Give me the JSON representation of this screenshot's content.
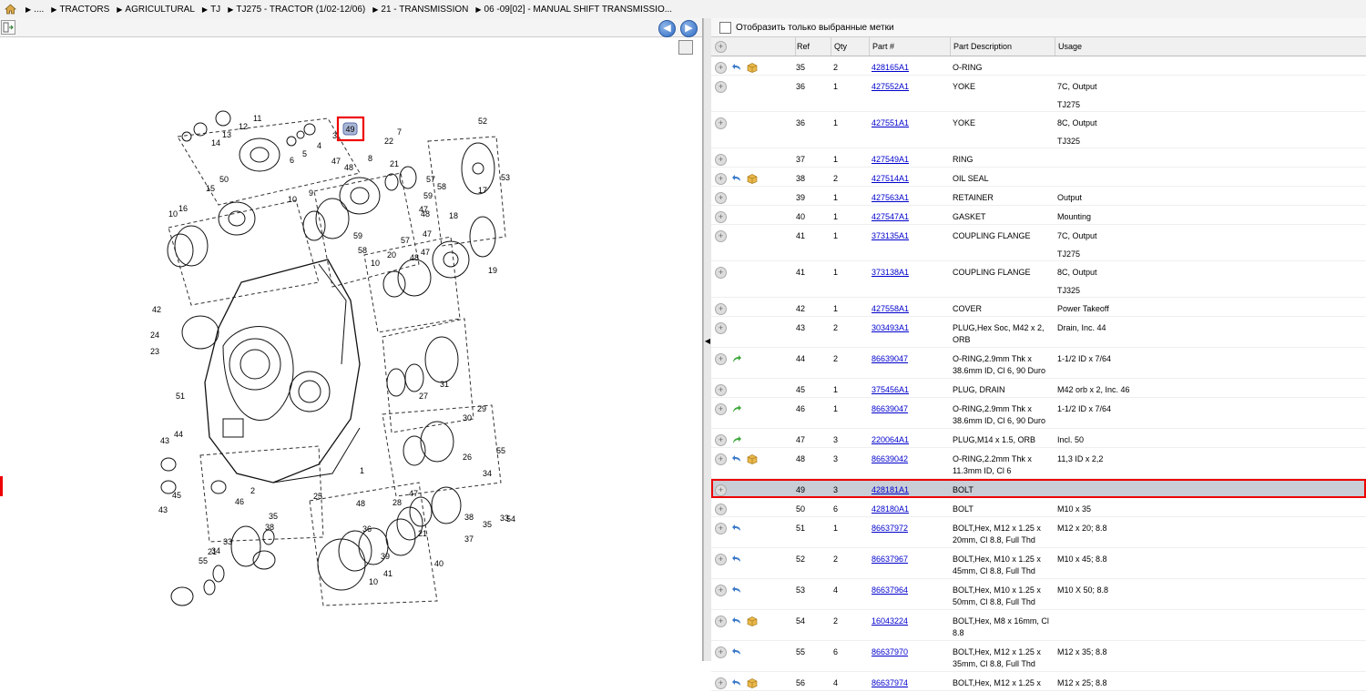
{
  "breadcrumb": {
    "items": [
      "....",
      "TRACTORS",
      "AGRICULTURAL",
      "TJ",
      "TJ275 - TRACTOR (1/02-12/06)",
      "21 - TRANSMISSION",
      "06 -09[02] - MANUAL SHIFT TRANSMISSIO..."
    ]
  },
  "diagram": {
    "highlight_label": "49",
    "callouts": [
      "11",
      "12",
      "13",
      "14",
      "6",
      "5",
      "4",
      "3",
      "49",
      "52",
      "7",
      "22",
      "8",
      "47",
      "48",
      "21",
      "57",
      "58",
      "59",
      "17",
      "53",
      "50",
      "15",
      "16",
      "10",
      "9",
      "10",
      "47",
      "48",
      "59",
      "57",
      "47",
      "18",
      "58",
      "47",
      "48",
      "20",
      "19",
      "10",
      "42",
      "24",
      "23",
      "51",
      "43",
      "44",
      "43",
      "45",
      "46",
      "2",
      "1",
      "25",
      "27",
      "31",
      "30",
      "29",
      "55",
      "26",
      "34",
      "33",
      "35",
      "54",
      "28",
      "47",
      "48",
      "36",
      "37",
      "38",
      "21",
      "40",
      "39",
      "10",
      "41",
      "38",
      "35",
      "34",
      "33",
      "55",
      "21"
    ]
  },
  "filter": {
    "label": "Отобразить только выбранные метки"
  },
  "table": {
    "headers": [
      "Ref",
      "Qty",
      "Part #",
      "Part Description",
      "Usage"
    ],
    "rows": [
      {
        "ref": "35",
        "qty": "2",
        "part": "428165A1",
        "desc": [
          "O-RING"
        ],
        "usage": [],
        "icons": [
          "undo",
          "box"
        ]
      },
      {
        "ref": "36",
        "qty": "1",
        "part": "427552A1",
        "desc": [
          "YOKE"
        ],
        "usage": [
          "7C, Output",
          "TJ275"
        ],
        "icons": []
      },
      {
        "ref": "36",
        "qty": "1",
        "part": "427551A1",
        "desc": [
          "YOKE"
        ],
        "usage": [
          "8C, Output",
          "TJ325"
        ],
        "icons": []
      },
      {
        "ref": "37",
        "qty": "1",
        "part": "427549A1",
        "desc": [
          "RING"
        ],
        "usage": [],
        "icons": []
      },
      {
        "ref": "38",
        "qty": "2",
        "part": "427514A1",
        "desc": [
          "OIL SEAL"
        ],
        "usage": [],
        "icons": [
          "undo",
          "box"
        ]
      },
      {
        "ref": "39",
        "qty": "1",
        "part": "427563A1",
        "desc": [
          "RETAINER"
        ],
        "usage": [
          "Output"
        ],
        "icons": []
      },
      {
        "ref": "40",
        "qty": "1",
        "part": "427547A1",
        "desc": [
          "GASKET"
        ],
        "usage": [
          "Mounting"
        ],
        "icons": []
      },
      {
        "ref": "41",
        "qty": "1",
        "part": "373135A1",
        "desc": [
          "COUPLING FLANGE"
        ],
        "usage": [
          "7C, Output",
          "TJ275"
        ],
        "icons": []
      },
      {
        "ref": "41",
        "qty": "1",
        "part": "373138A1",
        "desc": [
          "COUPLING FLANGE"
        ],
        "usage": [
          "8C, Output",
          "TJ325"
        ],
        "icons": []
      },
      {
        "ref": "42",
        "qty": "1",
        "part": "427558A1",
        "desc": [
          "COVER"
        ],
        "usage": [
          "Power Takeoff"
        ],
        "icons": []
      },
      {
        "ref": "43",
        "qty": "2",
        "part": "303493A1",
        "desc": [
          "PLUG,Hex Soc, M42 x 2,",
          "ORB"
        ],
        "usage": [
          "Drain, Inc. 44"
        ],
        "icons": []
      },
      {
        "ref": "44",
        "qty": "2",
        "part": "86639047",
        "desc": [
          "O-RING,2.9mm Thk x",
          "38.6mm ID, Cl 6, 90 Duro"
        ],
        "usage": [
          "1-1/2 ID x 7/64"
        ],
        "icons": [
          "redo"
        ]
      },
      {
        "ref": "45",
        "qty": "1",
        "part": "375456A1",
        "desc": [
          "PLUG, DRAIN"
        ],
        "usage": [
          "M42 orb x 2, Inc. 46"
        ],
        "icons": []
      },
      {
        "ref": "46",
        "qty": "1",
        "part": "86639047",
        "desc": [
          "O-RING,2.9mm Thk x",
          "38.6mm ID, Cl 6, 90 Duro"
        ],
        "usage": [
          "1-1/2 ID x 7/64"
        ],
        "icons": [
          "redo"
        ]
      },
      {
        "ref": "47",
        "qty": "3",
        "part": "220064A1",
        "desc": [
          "PLUG,M14 x 1.5, ORB"
        ],
        "usage": [
          "Incl. 50"
        ],
        "icons": [
          "redo"
        ]
      },
      {
        "ref": "48",
        "qty": "3",
        "part": "86639042",
        "desc": [
          "O-RING,2.2mm Thk x",
          "11.3mm ID, Cl 6"
        ],
        "usage": [
          "11,3 ID x 2,2"
        ],
        "icons": [
          "undo",
          "box"
        ]
      },
      {
        "ref": "49",
        "qty": "3",
        "part": "428181A1",
        "desc": [
          "BOLT"
        ],
        "usage": [],
        "icons": [],
        "selected": true
      },
      {
        "ref": "50",
        "qty": "6",
        "part": "428180A1",
        "desc": [
          "BOLT"
        ],
        "usage": [
          "M10 x 35"
        ],
        "icons": []
      },
      {
        "ref": "51",
        "qty": "1",
        "part": "86637972",
        "desc": [
          "BOLT,Hex, M12 x 1.25 x",
          "20mm, Cl 8.8, Full Thd"
        ],
        "usage": [
          "M12 x 20; 8.8"
        ],
        "icons": [
          "undo"
        ]
      },
      {
        "ref": "52",
        "qty": "2",
        "part": "86637967",
        "desc": [
          "BOLT,Hex, M10 x 1.25 x",
          "45mm, Cl 8.8, Full Thd"
        ],
        "usage": [
          "M10 x 45; 8.8"
        ],
        "icons": [
          "undo"
        ]
      },
      {
        "ref": "53",
        "qty": "4",
        "part": "86637964",
        "desc": [
          "BOLT,Hex, M10 x 1.25 x",
          "50mm, Cl 8.8, Full Thd"
        ],
        "usage": [
          "M10 X 50; 8.8"
        ],
        "icons": [
          "undo"
        ]
      },
      {
        "ref": "54",
        "qty": "2",
        "part": "16043224",
        "desc": [
          "BOLT,Hex, M8 x 16mm, Cl",
          "8.8"
        ],
        "usage": [],
        "icons": [
          "undo",
          "box"
        ]
      },
      {
        "ref": "55",
        "qty": "6",
        "part": "86637970",
        "desc": [
          "BOLT,Hex, M12 x 1.25 x",
          "35mm, Cl 8.8, Full Thd"
        ],
        "usage": [
          "M12 x 35; 8.8"
        ],
        "icons": [
          "undo"
        ]
      },
      {
        "ref": "56",
        "qty": "4",
        "part": "86637974",
        "desc": [
          "BOLT,Hex, M12 x 1.25 x"
        ],
        "usage": [
          "M12 x 25; 8.8"
        ],
        "icons": [
          "undo",
          "box"
        ]
      }
    ]
  }
}
